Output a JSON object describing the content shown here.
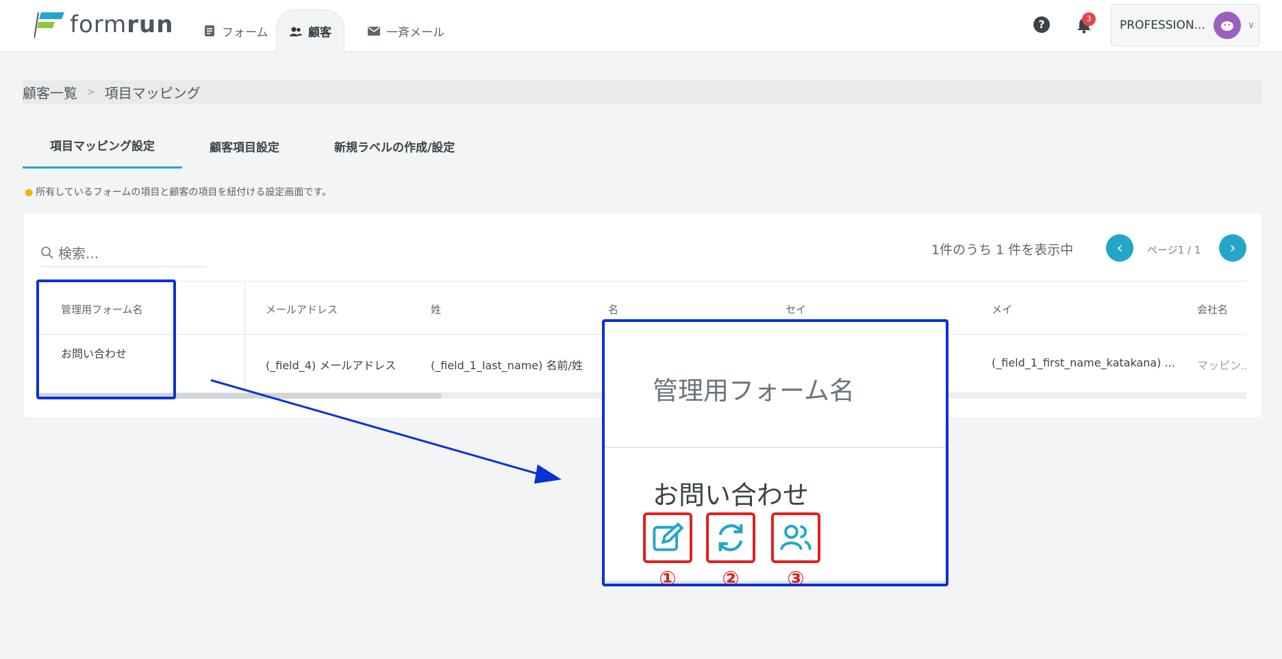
{
  "app": {
    "logo_text_light": "form",
    "logo_text_bold": "run"
  },
  "nav": {
    "tabs": [
      {
        "label": "フォーム",
        "icon": "form-icon"
      },
      {
        "label": "顧客",
        "icon": "people-icon",
        "active": true
      },
      {
        "label": "一斉メール",
        "icon": "mail-icon"
      }
    ],
    "help_glyph": "?",
    "notification_count": "3",
    "account_name": "PROFESSION..."
  },
  "breadcrumb": {
    "items": [
      "顧客一覧",
      "項目マッピング"
    ],
    "separator": ">"
  },
  "tabs": [
    {
      "label": "項目マッピング設定",
      "active": true
    },
    {
      "label": "顧客項目設定"
    },
    {
      "label": "新規ラベルの作成/設定"
    }
  ],
  "hint": "所有しているフォームの項目と顧客の項目を紐付ける設定画面です。",
  "search": {
    "placeholder": "検索..."
  },
  "pagination": {
    "summary": "1件のうち 1 件を表示中",
    "page_label": "ページ1 / 1",
    "prev_glyph": "‹",
    "next_glyph": "›"
  },
  "table": {
    "headers": [
      "管理用フォーム名",
      "メールアドレス",
      "姓",
      "名",
      "セイ",
      "メイ",
      "会社名"
    ],
    "row": {
      "form_name": "お問い合わせ",
      "cells": [
        "(_field_4) メールアドレス",
        "(_field_1_last_name) 名前/姓",
        "(_field_1_first_name_katakana) ...",
        "マッピン..."
      ],
      "actions": [
        "edit-icon",
        "sync-icon",
        "users-icon"
      ]
    }
  },
  "zoom": {
    "header": "管理用フォーム名",
    "title": "お問い合わせ",
    "numbers": [
      "①",
      "②",
      "③"
    ]
  },
  "colors": {
    "accent": "#23a6c9",
    "annotation_blue": "#0a31d6",
    "annotation_red": "#e0201d",
    "badge_red": "#e0474c"
  }
}
